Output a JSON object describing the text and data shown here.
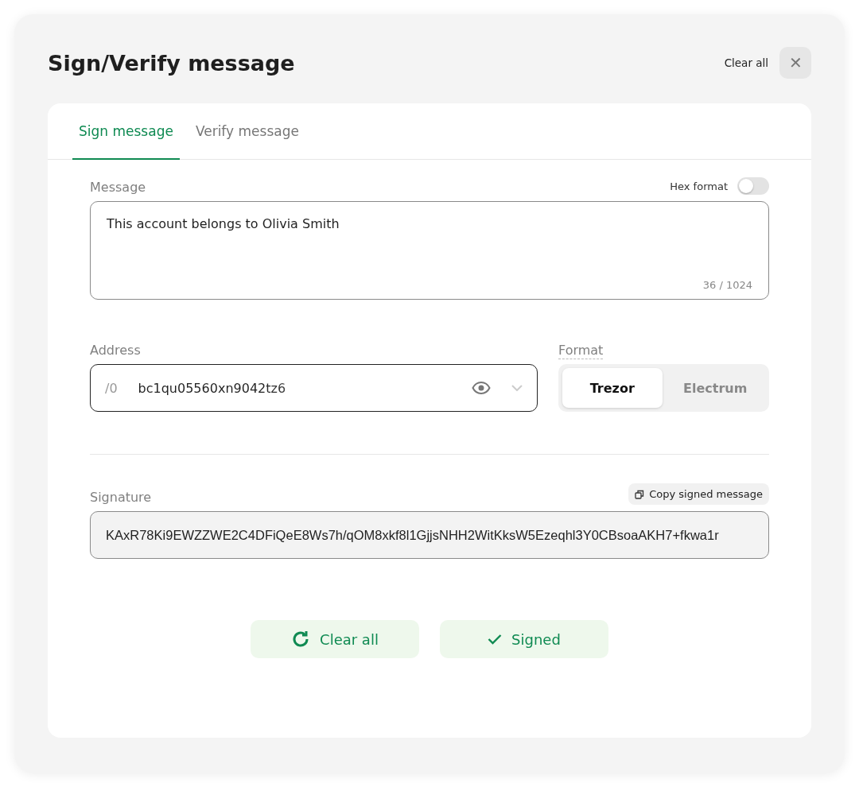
{
  "header": {
    "title": "Sign/Verify message",
    "clear_label": "Clear all",
    "close_label": "✕"
  },
  "tabs": [
    {
      "label": "Sign message",
      "selected": true
    },
    {
      "label": "Verify message",
      "selected": false
    }
  ],
  "message": {
    "label": "Message",
    "hex_label": "Hex format",
    "hex_on": false,
    "value": "This account belongs to Olivia Smith",
    "counter": "36 / 1024"
  },
  "address": {
    "label": "Address",
    "path": "/0",
    "value": "bc1qu05560xn9042tz6"
  },
  "format": {
    "label": "Format",
    "options": [
      {
        "label": "Trezor",
        "selected": true
      },
      {
        "label": "Electrum",
        "selected": false
      }
    ]
  },
  "signature": {
    "label": "Signature",
    "copy_label": "Copy signed message",
    "value": "KAxR78Ki9EWZZWE2C4DFiQeE8Ws7h/qOM8xkf8l1GjjsNHH2WitKksW5Ezeqhl3Y0CBsoaAKH7+fkwa1r"
  },
  "actions": [
    {
      "kind": "reset",
      "label": "Clear all"
    },
    {
      "kind": "done",
      "label": "Signed"
    }
  ]
}
